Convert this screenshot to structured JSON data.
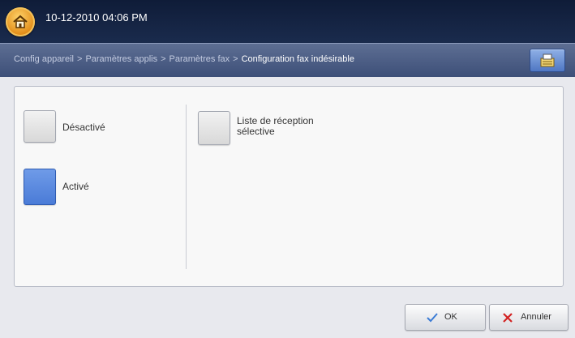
{
  "header": {
    "datetime": "10-12-2010 04:06 PM",
    "home_icon": "home-icon"
  },
  "breadcrumb": {
    "items": [
      "Config appareil",
      "Paramètres applis",
      "Paramètres fax"
    ],
    "separator": ">",
    "current": "Configuration fax indésirable"
  },
  "job_status_icon": "job-status-icon",
  "options": {
    "off_label": "Désactivé",
    "on_label": "Activé",
    "selected": "on",
    "list_label_line1": "Liste de réception",
    "list_label_line2": "sélective"
  },
  "footer": {
    "ok_label": "OK",
    "cancel_label": "Annuler"
  },
  "colors": {
    "selected": "#4a7bd7",
    "ok_check": "#3a7bd5",
    "cancel_x": "#d22222"
  }
}
